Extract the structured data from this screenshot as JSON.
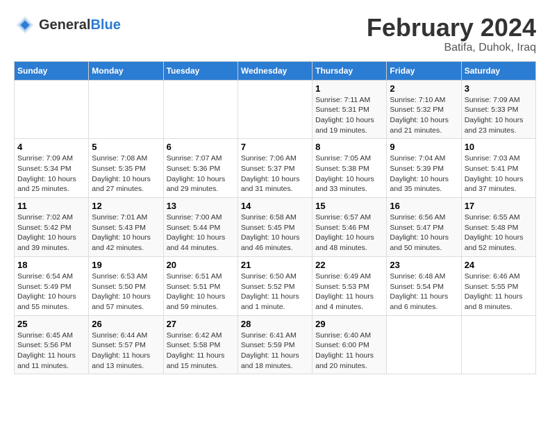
{
  "header": {
    "logo_text_general": "General",
    "logo_text_blue": "Blue",
    "title": "February 2024",
    "subtitle": "Batifa, Duhok, Iraq"
  },
  "calendar": {
    "days_of_week": [
      "Sunday",
      "Monday",
      "Tuesday",
      "Wednesday",
      "Thursday",
      "Friday",
      "Saturday"
    ],
    "weeks": [
      [
        {
          "day": "",
          "info": ""
        },
        {
          "day": "",
          "info": ""
        },
        {
          "day": "",
          "info": ""
        },
        {
          "day": "",
          "info": ""
        },
        {
          "day": "1",
          "info": "Sunrise: 7:11 AM\nSunset: 5:31 PM\nDaylight: 10 hours\nand 19 minutes."
        },
        {
          "day": "2",
          "info": "Sunrise: 7:10 AM\nSunset: 5:32 PM\nDaylight: 10 hours\nand 21 minutes."
        },
        {
          "day": "3",
          "info": "Sunrise: 7:09 AM\nSunset: 5:33 PM\nDaylight: 10 hours\nand 23 minutes."
        }
      ],
      [
        {
          "day": "4",
          "info": "Sunrise: 7:09 AM\nSunset: 5:34 PM\nDaylight: 10 hours\nand 25 minutes."
        },
        {
          "day": "5",
          "info": "Sunrise: 7:08 AM\nSunset: 5:35 PM\nDaylight: 10 hours\nand 27 minutes."
        },
        {
          "day": "6",
          "info": "Sunrise: 7:07 AM\nSunset: 5:36 PM\nDaylight: 10 hours\nand 29 minutes."
        },
        {
          "day": "7",
          "info": "Sunrise: 7:06 AM\nSunset: 5:37 PM\nDaylight: 10 hours\nand 31 minutes."
        },
        {
          "day": "8",
          "info": "Sunrise: 7:05 AM\nSunset: 5:38 PM\nDaylight: 10 hours\nand 33 minutes."
        },
        {
          "day": "9",
          "info": "Sunrise: 7:04 AM\nSunset: 5:39 PM\nDaylight: 10 hours\nand 35 minutes."
        },
        {
          "day": "10",
          "info": "Sunrise: 7:03 AM\nSunset: 5:41 PM\nDaylight: 10 hours\nand 37 minutes."
        }
      ],
      [
        {
          "day": "11",
          "info": "Sunrise: 7:02 AM\nSunset: 5:42 PM\nDaylight: 10 hours\nand 39 minutes."
        },
        {
          "day": "12",
          "info": "Sunrise: 7:01 AM\nSunset: 5:43 PM\nDaylight: 10 hours\nand 42 minutes."
        },
        {
          "day": "13",
          "info": "Sunrise: 7:00 AM\nSunset: 5:44 PM\nDaylight: 10 hours\nand 44 minutes."
        },
        {
          "day": "14",
          "info": "Sunrise: 6:58 AM\nSunset: 5:45 PM\nDaylight: 10 hours\nand 46 minutes."
        },
        {
          "day": "15",
          "info": "Sunrise: 6:57 AM\nSunset: 5:46 PM\nDaylight: 10 hours\nand 48 minutes."
        },
        {
          "day": "16",
          "info": "Sunrise: 6:56 AM\nSunset: 5:47 PM\nDaylight: 10 hours\nand 50 minutes."
        },
        {
          "day": "17",
          "info": "Sunrise: 6:55 AM\nSunset: 5:48 PM\nDaylight: 10 hours\nand 52 minutes."
        }
      ],
      [
        {
          "day": "18",
          "info": "Sunrise: 6:54 AM\nSunset: 5:49 PM\nDaylight: 10 hours\nand 55 minutes."
        },
        {
          "day": "19",
          "info": "Sunrise: 6:53 AM\nSunset: 5:50 PM\nDaylight: 10 hours\nand 57 minutes."
        },
        {
          "day": "20",
          "info": "Sunrise: 6:51 AM\nSunset: 5:51 PM\nDaylight: 10 hours\nand 59 minutes."
        },
        {
          "day": "21",
          "info": "Sunrise: 6:50 AM\nSunset: 5:52 PM\nDaylight: 11 hours\nand 1 minute."
        },
        {
          "day": "22",
          "info": "Sunrise: 6:49 AM\nSunset: 5:53 PM\nDaylight: 11 hours\nand 4 minutes."
        },
        {
          "day": "23",
          "info": "Sunrise: 6:48 AM\nSunset: 5:54 PM\nDaylight: 11 hours\nand 6 minutes."
        },
        {
          "day": "24",
          "info": "Sunrise: 6:46 AM\nSunset: 5:55 PM\nDaylight: 11 hours\nand 8 minutes."
        }
      ],
      [
        {
          "day": "25",
          "info": "Sunrise: 6:45 AM\nSunset: 5:56 PM\nDaylight: 11 hours\nand 11 minutes."
        },
        {
          "day": "26",
          "info": "Sunrise: 6:44 AM\nSunset: 5:57 PM\nDaylight: 11 hours\nand 13 minutes."
        },
        {
          "day": "27",
          "info": "Sunrise: 6:42 AM\nSunset: 5:58 PM\nDaylight: 11 hours\nand 15 minutes."
        },
        {
          "day": "28",
          "info": "Sunrise: 6:41 AM\nSunset: 5:59 PM\nDaylight: 11 hours\nand 18 minutes."
        },
        {
          "day": "29",
          "info": "Sunrise: 6:40 AM\nSunset: 6:00 PM\nDaylight: 11 hours\nand 20 minutes."
        },
        {
          "day": "",
          "info": ""
        },
        {
          "day": "",
          "info": ""
        }
      ]
    ]
  }
}
